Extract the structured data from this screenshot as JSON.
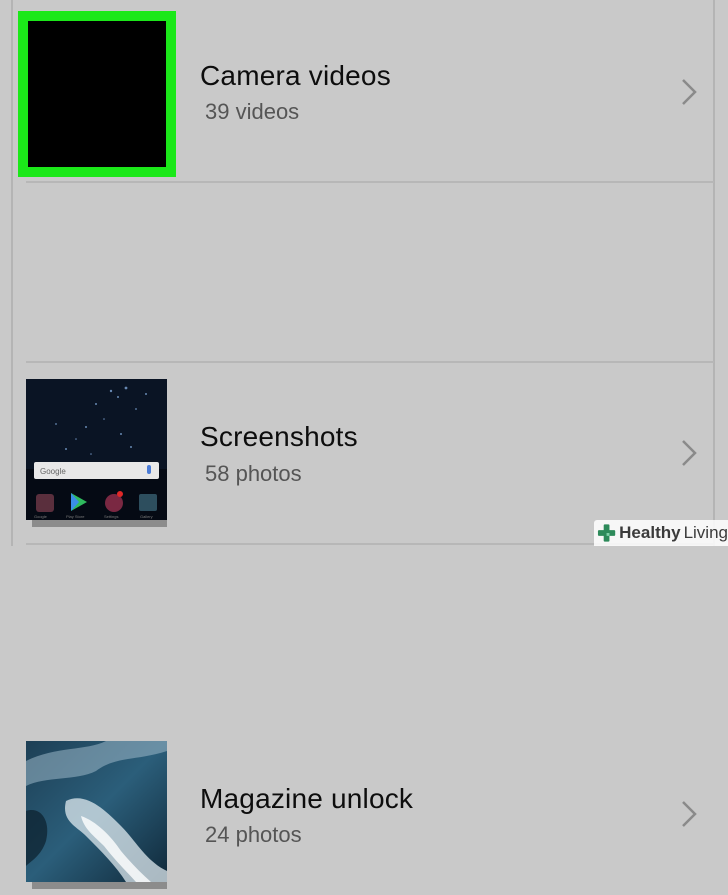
{
  "albums": [
    {
      "title": "Camera videos",
      "count": "39 videos"
    },
    {
      "title": "Screenshots",
      "count": "58 photos"
    },
    {
      "title": "Magazine unlock",
      "count": "24 photos"
    }
  ],
  "screenshot_thumb": {
    "search_label": "Google",
    "app_labels": [
      "Google",
      "Play Store",
      "Settings",
      "Gallery"
    ]
  },
  "watermark": {
    "part1": "Healthy",
    "part2": "Living"
  },
  "colors": {
    "background": "#c9c9c9",
    "highlight_border": "#1be819",
    "title_text": "#0d0d0d",
    "count_text": "#555555",
    "chevron": "#8a8a8a"
  }
}
